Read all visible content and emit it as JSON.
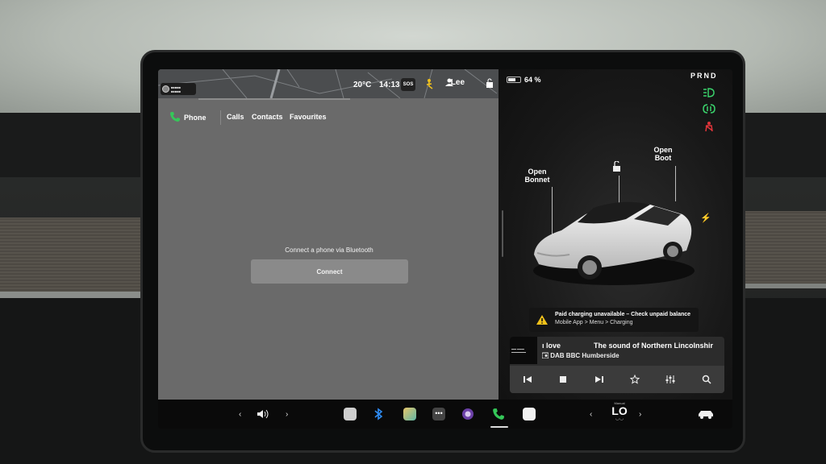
{
  "top_status": {
    "temperature": "20°C",
    "time": "14:13",
    "sos_label": "SOS",
    "user_name": "Lee"
  },
  "phone_app": {
    "title": "Phone",
    "tabs": [
      "Calls",
      "Contacts",
      "Favourites"
    ],
    "bluetooth_message": "Connect a phone via Bluetooth",
    "connect_label": "Connect"
  },
  "vehicle": {
    "battery_percent_label": "64 %",
    "battery_level": 0.64,
    "gear_selector": "PRND",
    "open_bonnet_label": "Open\nBonnet",
    "open_boot_label": "Open\nBoot",
    "alert": {
      "title": "Paid charging unavailable – Check unpaid balance",
      "subtitle": "Mobile App > Menu > Charging"
    },
    "indicator_colors": {
      "headlights": "#3ad16b",
      "fog_lights": "#3ad16b",
      "seatbelt_warning": "#e0353a"
    }
  },
  "media": {
    "song_fragment": "ı love",
    "scrolling_text": "The sound of Northern Lincolnshir",
    "station": "DAB BBC Humberside"
  },
  "dock": {
    "climate_mode": "Manual",
    "climate_value": "LO"
  },
  "colors": {
    "phone_green": "#35c759",
    "bluetooth_blue": "#2f8df5",
    "alert_yellow": "#f2c21b"
  }
}
